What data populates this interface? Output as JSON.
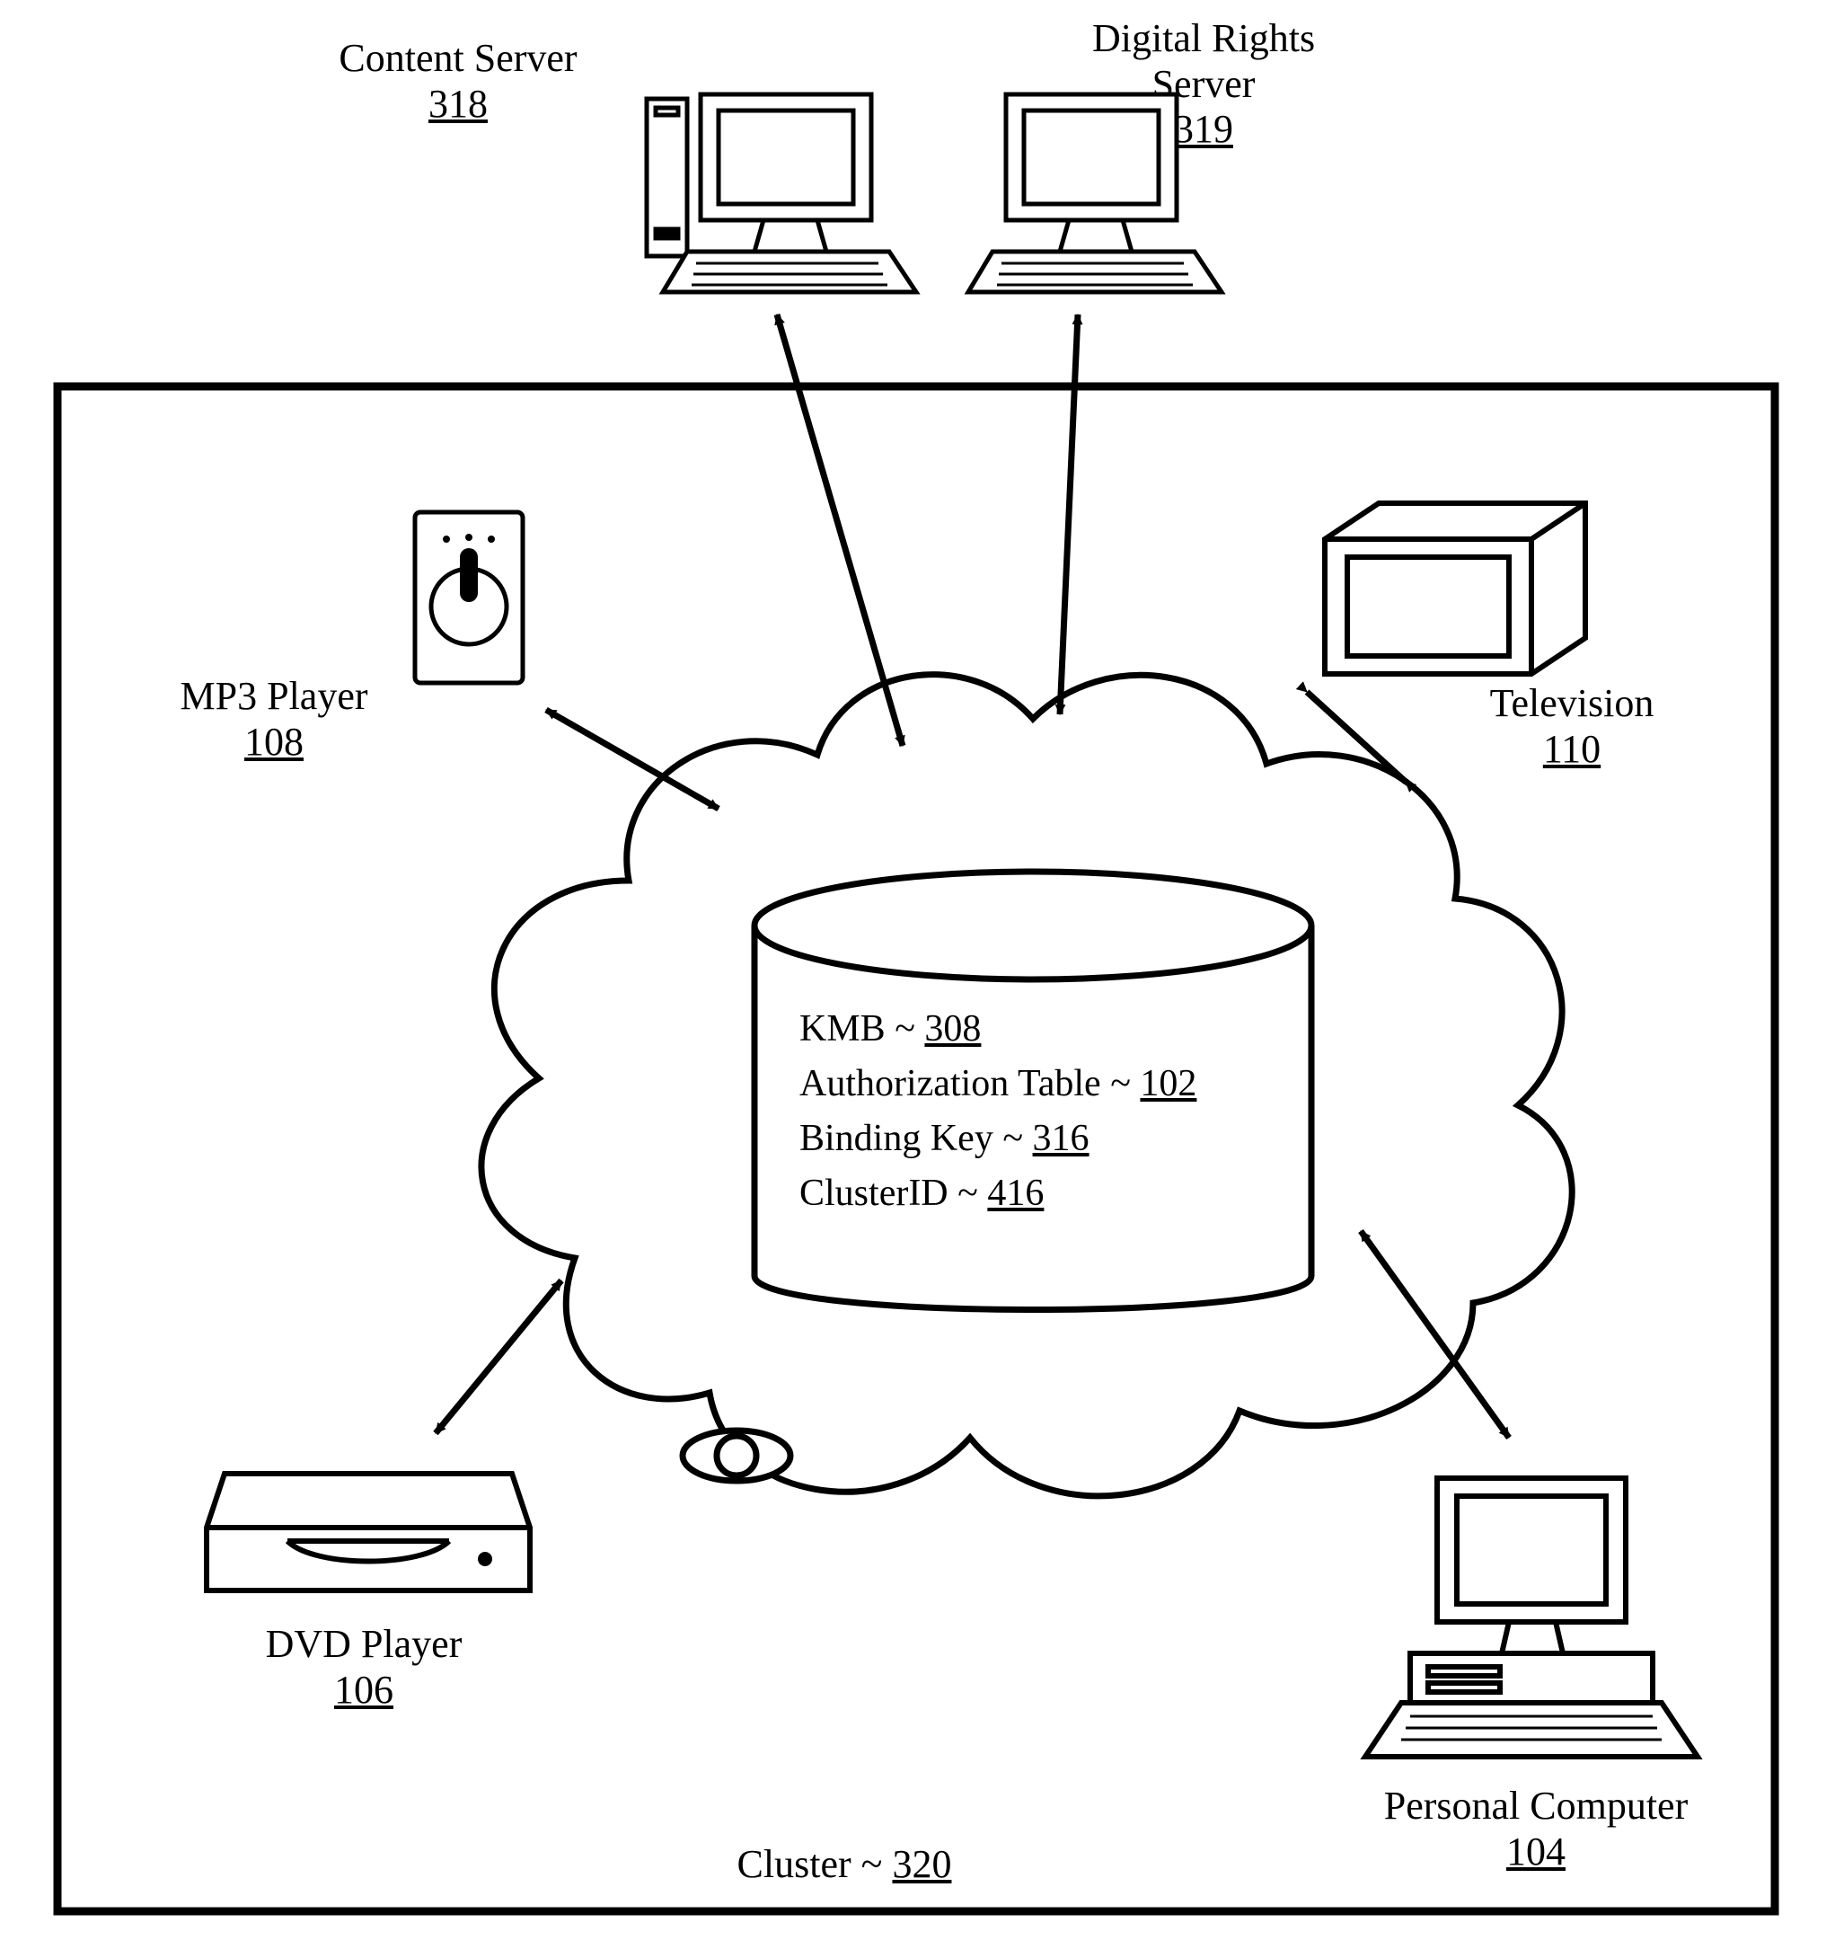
{
  "external": {
    "content_server": {
      "label": "Content Server",
      "ref": "318"
    },
    "digital_rights_server": {
      "label1": "Digital Rights",
      "label2": "Server",
      "ref": "319"
    }
  },
  "cluster": {
    "label": "Cluster ~ ",
    "ref": "320",
    "devices": {
      "mp3_player": {
        "label": "MP3 Player",
        "ref": "108"
      },
      "television": {
        "label": "Television",
        "ref": "110"
      },
      "dvd_player": {
        "label": "DVD Player",
        "ref": "106"
      },
      "personal_computer": {
        "label": "Personal Computer",
        "ref": "104"
      }
    },
    "store": {
      "kmb": {
        "label": "KMB ~ ",
        "ref": "308"
      },
      "auth_table": {
        "label": "Authorization Table ~ ",
        "ref": "102"
      },
      "binding_key": {
        "label": "Binding Key ~ ",
        "ref": "316"
      },
      "cluster_id": {
        "label": "ClusterID ~ ",
        "ref": "416"
      }
    }
  }
}
